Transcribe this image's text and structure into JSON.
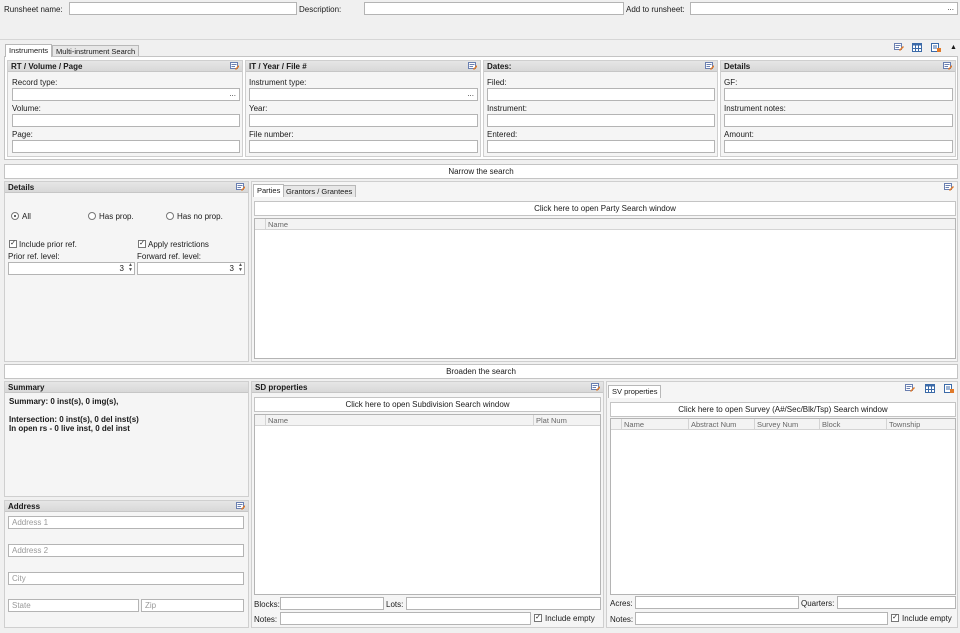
{
  "top": {
    "runsheet_name_label": "Runsheet name:",
    "runsheet_name_value": "",
    "description_label": "Description:",
    "description_value": "",
    "add_to_runsheet_label": "Add to runsheet:",
    "add_to_runsheet_value": "",
    "add_to_runsheet_dots": "..."
  },
  "main_tabs": [
    {
      "label": "Instruments"
    },
    {
      "label": "Multi-instrument Search"
    }
  ],
  "instruments": {
    "rt": {
      "title": "RT / Volume / Page",
      "record_type_label": "Record type:",
      "record_type_dots": "...",
      "volume_label": "Volume:",
      "page_label": "Page:"
    },
    "it": {
      "title": "IT / Year / File #",
      "instrument_type_label": "Instrument type:",
      "instrument_type_dots": "...",
      "year_label": "Year:",
      "file_number_label": "File number:"
    },
    "dates": {
      "title": "Dates:",
      "filed_label": "Filed:",
      "instrument_label": "Instrument:",
      "entered_label": "Entered:"
    },
    "details": {
      "title": "Details",
      "gf_label": "GF:",
      "instrument_notes_label": "Instrument notes:",
      "amount_label": "Amount:"
    }
  },
  "narrow_label": "Narrow the search",
  "details2": {
    "title": "Details",
    "radio_all": "All",
    "radio_has_prop": "Has prop.",
    "radio_has_no_prop": "Has no prop.",
    "include_prior_ref": "Include prior ref.",
    "apply_restrictions": "Apply restrictions",
    "prior_ref_level_label": "Prior ref. level:",
    "prior_ref_level_value": "3",
    "forward_ref_level_label": "Forward ref. level:",
    "forward_ref_level_value": "3"
  },
  "parties": {
    "tabs": [
      {
        "label": "Parties"
      },
      {
        "label": "Grantors / Grantees"
      }
    ],
    "open_button": "Click here to open Party Search window",
    "columns": [
      "Name"
    ]
  },
  "broaden_label": "Broaden the search",
  "summary": {
    "title": "Summary",
    "line1": "Summary: 0 inst(s), 0 img(s),",
    "line2": "Intersection: 0 inst(s), 0 del inst(s)",
    "line3": "In open rs - 0 live inst, 0 del inst"
  },
  "address": {
    "title": "Address",
    "address1_placeholder": "Address 1",
    "address2_placeholder": "Address 2",
    "city_placeholder": "City",
    "state_placeholder": "State",
    "zip_placeholder": "Zip"
  },
  "sd": {
    "title": "SD properties",
    "open_button": "Click here to open Subdivision Search window",
    "columns": [
      "Name",
      "Plat Num"
    ],
    "blocks_label": "Blocks:",
    "lots_label": "Lots:",
    "notes_label": "Notes:",
    "include_empty": "Include empty"
  },
  "sv": {
    "tab": "SV properties",
    "open_button": "Click here to open Survey (A#/Sec/Blk/Tsp) Search window",
    "columns": [
      "Name",
      "Abstract Num",
      "Survey Num",
      "Block",
      "Township"
    ],
    "acres_label": "Acres:",
    "quarters_label": "Quarters:",
    "notes_label": "Notes:",
    "include_empty": "Include empty"
  }
}
